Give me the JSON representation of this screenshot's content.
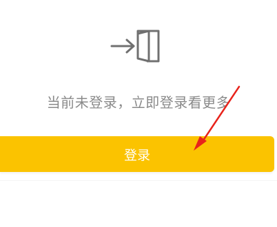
{
  "prompt": {
    "message": "当前未登录，立即登录看更多"
  },
  "login_button": {
    "label": "登录"
  },
  "icons": {
    "login": "login-door-icon",
    "annotation": "red-arrow-annotation"
  },
  "colors": {
    "accent": "#fbc300",
    "text_muted": "#8a8a8a",
    "icon_gray": "#707070",
    "annotation_red": "#e8231b"
  }
}
